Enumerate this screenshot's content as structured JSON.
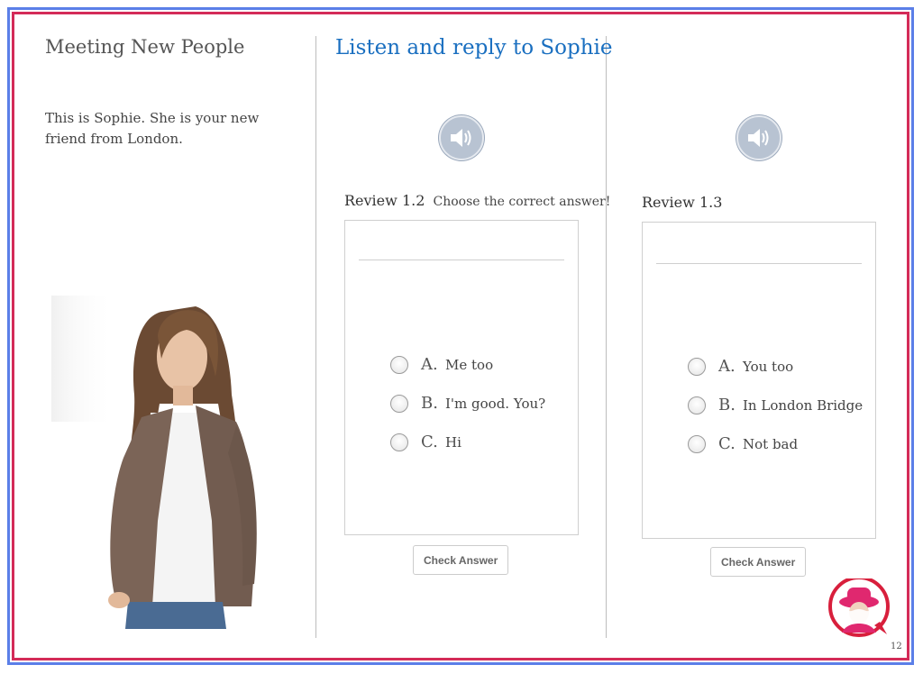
{
  "left": {
    "title": "Meeting New People",
    "intro": "This is Sophie. She is your new friend from London.",
    "photo_icon": "girl-photo"
  },
  "middle": {
    "heading": "Listen and reply to Sophie",
    "audio_icon": "speaker-icon",
    "review": {
      "label": "Review",
      "number": "1.2",
      "instruction": "Choose the correct answer!",
      "options": [
        {
          "letter": "A.",
          "text": "Me too"
        },
        {
          "letter": "B.",
          "text": "I'm good. You?"
        },
        {
          "letter": "C.",
          "text": "Hi"
        }
      ],
      "button": "Check Answer"
    }
  },
  "right": {
    "audio_icon": "speaker-icon",
    "review": {
      "label": "Review",
      "number": "1.3",
      "options": [
        {
          "letter": "A.",
          "text": "You too"
        },
        {
          "letter": "B.",
          "text": "In London Bridge"
        },
        {
          "letter": "C.",
          "text": "Not bad"
        }
      ],
      "button": "Check Answer"
    }
  },
  "footer": {
    "page_number": "12",
    "avatar_icon": "queen-avatar-icon"
  },
  "colors": {
    "frame_outer": "#5b7fe8",
    "frame_inner": "#d42b58",
    "heading": "#1a6fc0"
  }
}
